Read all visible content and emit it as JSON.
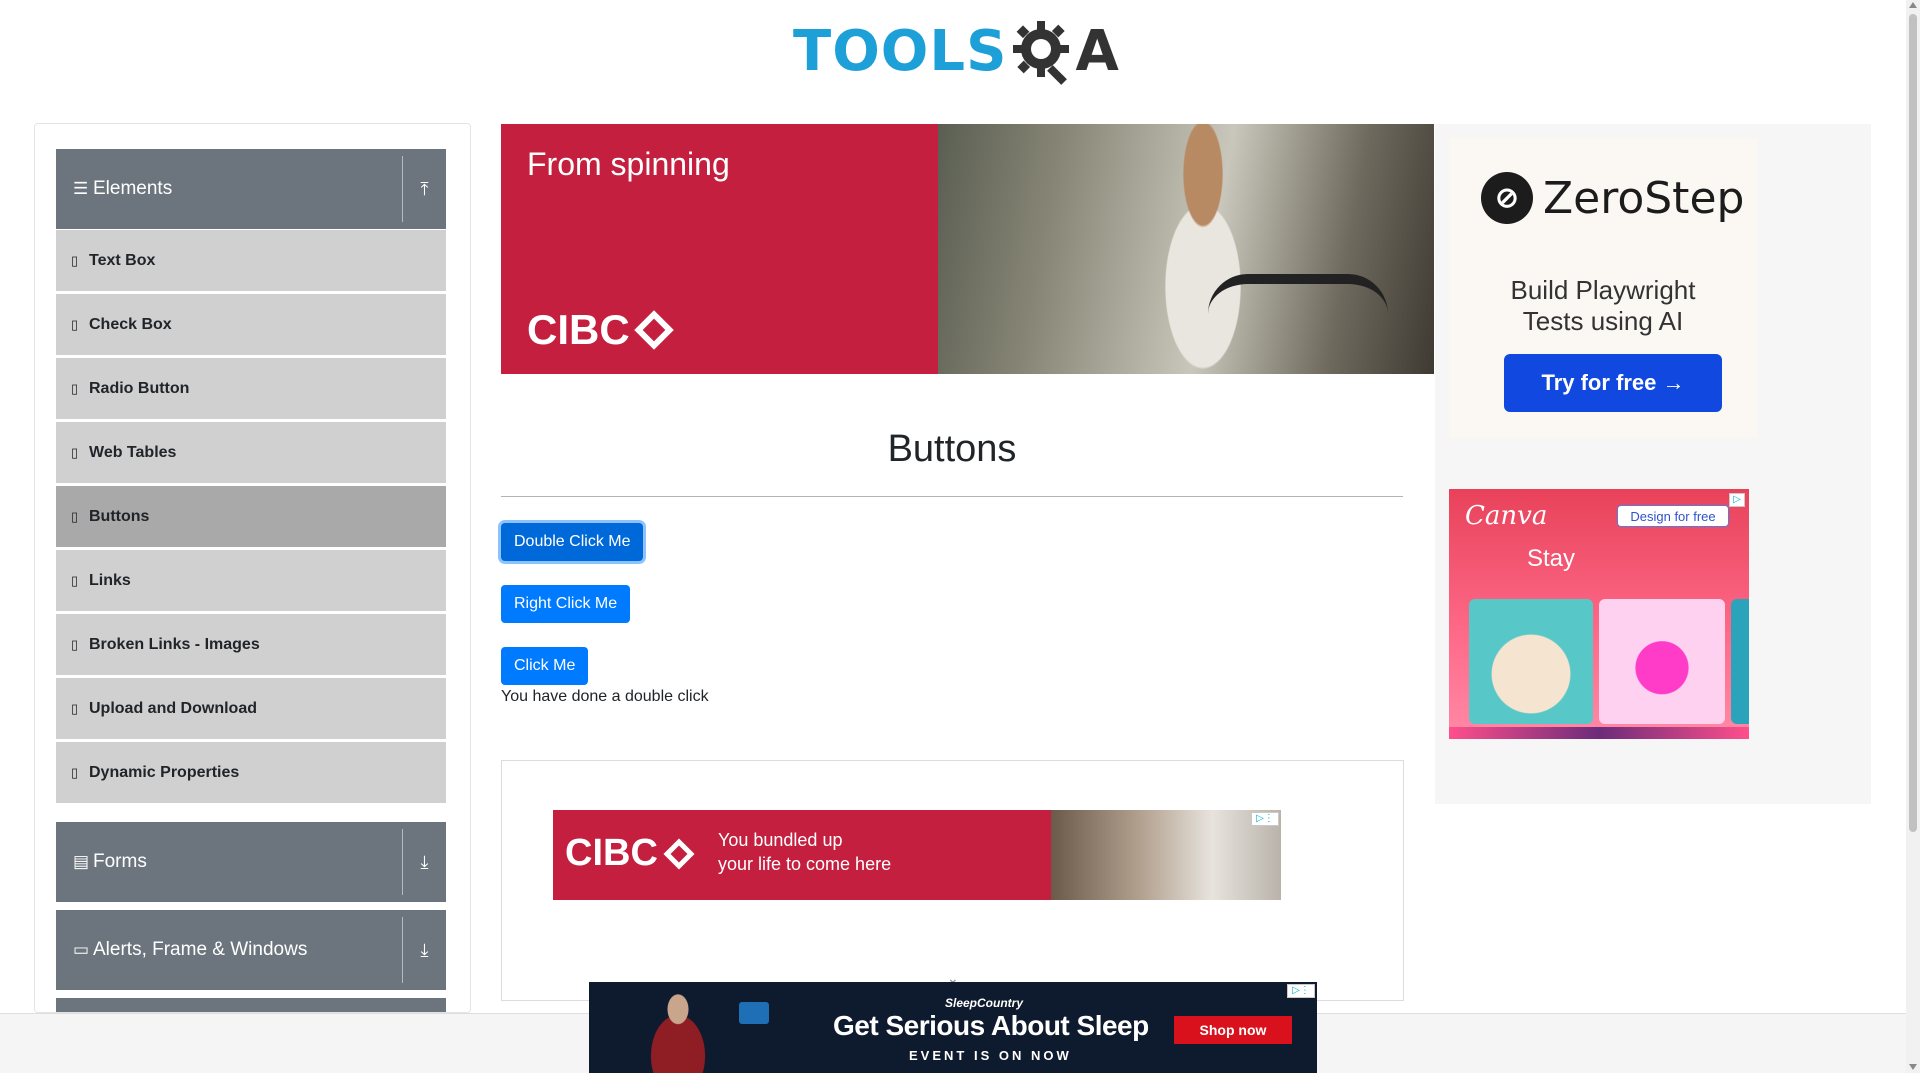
{
  "header": {
    "logo_part1": "TOOLS",
    "logo_part2": "A"
  },
  "sidebar": {
    "groups": [
      {
        "label": "Elements",
        "icon": "hamburger-icon",
        "toggle": "arrow-up-icon"
      },
      {
        "label": "Forms",
        "icon": "document-icon",
        "toggle": "arrow-down-icon"
      },
      {
        "label": "Alerts, Frame & Windows",
        "icon": "window-icon",
        "toggle": "arrow-down-icon"
      }
    ],
    "items": [
      {
        "label": "Text Box"
      },
      {
        "label": "Check Box"
      },
      {
        "label": "Radio Button"
      },
      {
        "label": "Web Tables"
      },
      {
        "label": "Buttons",
        "active": true
      },
      {
        "label": "Links"
      },
      {
        "label": "Broken Links - Images"
      },
      {
        "label": "Upload and Download"
      },
      {
        "label": "Dynamic Properties"
      }
    ]
  },
  "ad_top": {
    "text": "From spinning",
    "brand": "CIBC"
  },
  "main": {
    "title": "Buttons",
    "double_click_label": "Double Click Me",
    "right_click_label": "Right Click Me",
    "click_label": "Click Me",
    "message": "You have done a double click"
  },
  "ad_mid": {
    "brand": "CIBC",
    "line1": "You bundled up",
    "line2": "your life to come here"
  },
  "right_ads": {
    "zerostep": {
      "name": "ZeroStep",
      "tag1": "Build Playwright",
      "tag2": "Tests using AI",
      "cta": "Try for free →"
    },
    "canva": {
      "logo": "Canva",
      "cta": "Design for free",
      "text": "Stay"
    }
  },
  "ad_bottom": {
    "brand": "SleepCountry",
    "headline": "Get Serious About Sleep",
    "sub": "EVENT IS ON NOW",
    "cta": "Shop now"
  },
  "colors": {
    "primary": "#007bff",
    "sidebar_header": "#6c757d",
    "sidebar_item": "#d0d0d0",
    "sidebar_active": "#a9a9a9",
    "cibc_red": "#c41f3e"
  }
}
